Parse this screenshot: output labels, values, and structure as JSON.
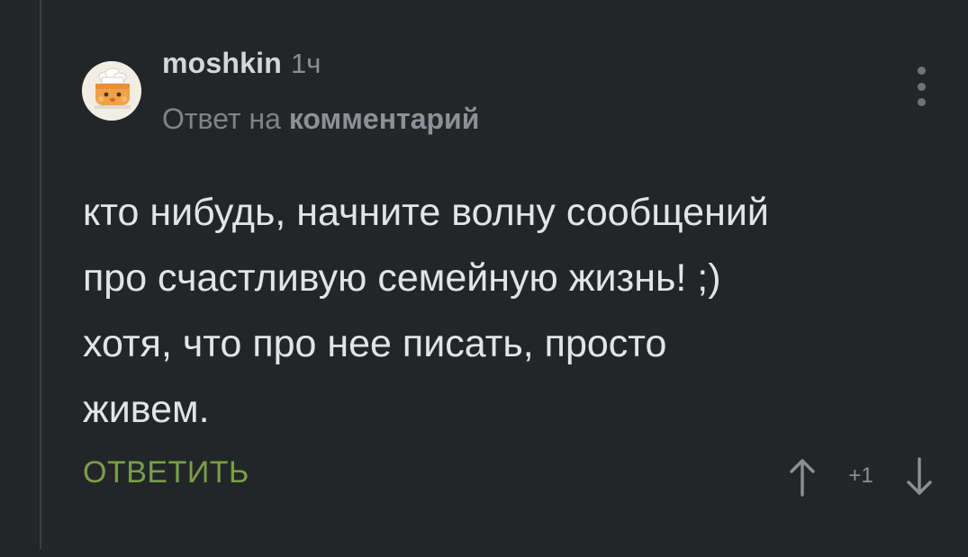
{
  "comment": {
    "author": "moshkin",
    "time": "1ч",
    "reply_prefix": "Ответ на",
    "reply_link": "комментарий",
    "text_lines": [
      "кто нибудь, начните волну сообщений",
      "про счастливую семейную жизнь! ;)",
      "хотя, что про нее писать, просто",
      "живем."
    ],
    "reply_button": "ОТВЕТИТЬ",
    "score": "+1",
    "icons": {
      "avatar": "chef-avatar-icon",
      "menu": "more-vertical-icon",
      "upvote": "arrow-up-icon",
      "downvote": "arrow-down-icon"
    },
    "colors": {
      "background": "#232629",
      "text": "#e4e4e4",
      "reply_button": "#7a9f48",
      "muted": "#8b8f93"
    }
  }
}
